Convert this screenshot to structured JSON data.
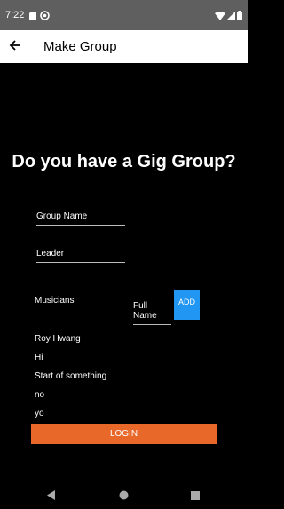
{
  "status_bar": {
    "time": "7:22",
    "icons_left": [
      "sd-card-icon",
      "at-sign-icon"
    ],
    "icons_right": [
      "wifi-icon",
      "cellular-signal-icon",
      "battery-icon"
    ]
  },
  "app_bar": {
    "title": "Make Group",
    "back_icon": "arrow-left-icon"
  },
  "heading": "Do you have a Gig Group?",
  "form": {
    "group_name": "Group Name",
    "leader": "Leader",
    "musicians_label": "Musicians",
    "full_name": "Full Name",
    "add_label": "ADD"
  },
  "musicians": [
    "Roy Hwang",
    "Hi",
    "Start of something",
    "no",
    "yo"
  ],
  "login_label": "LOGIN",
  "colors": {
    "add_button": "#2196f3",
    "login_button": "#e8682a",
    "status_bar": "#5f5f5f"
  },
  "nav_bar": {
    "icons": [
      "back-triangle-icon",
      "home-circle-icon",
      "recents-square-icon"
    ]
  }
}
